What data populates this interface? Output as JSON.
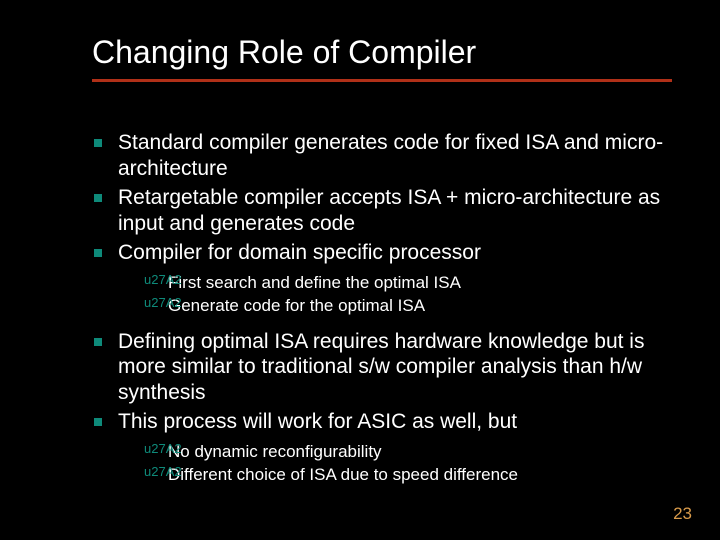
{
  "title": "Changing Role of Compiler",
  "bullets": {
    "b1": "Standard compiler generates code for fixed ISA and micro-architecture",
    "b2": "Retargetable compiler accepts ISA + micro-architecture as input and generates code",
    "b3": "Compiler for domain specific processor",
    "b3_sub": {
      "s1": "First search and define the optimal ISA",
      "s2": "Generate code for the optimal ISA"
    },
    "b4": "Defining optimal ISA requires hardware knowledge but is more similar to traditional s/w compiler analysis than h/w synthesis",
    "b5": "This process will work for ASIC as well, but",
    "b5_sub": {
      "s1": "No dynamic reconfigurability",
      "s2": "Different choice of ISA due to speed difference"
    }
  },
  "page_number": "23"
}
